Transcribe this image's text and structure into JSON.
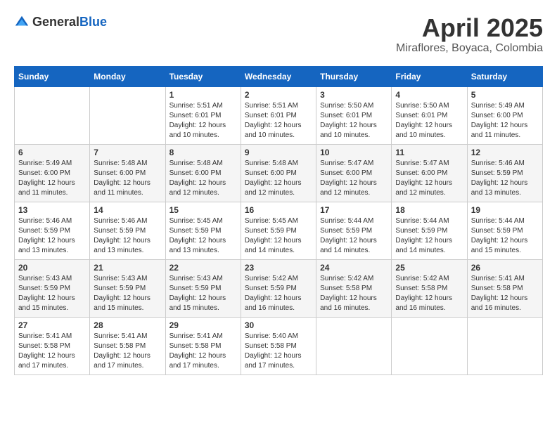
{
  "logo": {
    "general": "General",
    "blue": "Blue"
  },
  "title": "April 2025",
  "location": "Miraflores, Boyaca, Colombia",
  "days_of_week": [
    "Sunday",
    "Monday",
    "Tuesday",
    "Wednesday",
    "Thursday",
    "Friday",
    "Saturday"
  ],
  "weeks": [
    [
      {
        "day": "",
        "sunrise": "",
        "sunset": "",
        "daylight": ""
      },
      {
        "day": "",
        "sunrise": "",
        "sunset": "",
        "daylight": ""
      },
      {
        "day": "1",
        "sunrise": "Sunrise: 5:51 AM",
        "sunset": "Sunset: 6:01 PM",
        "daylight": "Daylight: 12 hours and 10 minutes."
      },
      {
        "day": "2",
        "sunrise": "Sunrise: 5:51 AM",
        "sunset": "Sunset: 6:01 PM",
        "daylight": "Daylight: 12 hours and 10 minutes."
      },
      {
        "day": "3",
        "sunrise": "Sunrise: 5:50 AM",
        "sunset": "Sunset: 6:01 PM",
        "daylight": "Daylight: 12 hours and 10 minutes."
      },
      {
        "day": "4",
        "sunrise": "Sunrise: 5:50 AM",
        "sunset": "Sunset: 6:01 PM",
        "daylight": "Daylight: 12 hours and 10 minutes."
      },
      {
        "day": "5",
        "sunrise": "Sunrise: 5:49 AM",
        "sunset": "Sunset: 6:00 PM",
        "daylight": "Daylight: 12 hours and 11 minutes."
      }
    ],
    [
      {
        "day": "6",
        "sunrise": "Sunrise: 5:49 AM",
        "sunset": "Sunset: 6:00 PM",
        "daylight": "Daylight: 12 hours and 11 minutes."
      },
      {
        "day": "7",
        "sunrise": "Sunrise: 5:48 AM",
        "sunset": "Sunset: 6:00 PM",
        "daylight": "Daylight: 12 hours and 11 minutes."
      },
      {
        "day": "8",
        "sunrise": "Sunrise: 5:48 AM",
        "sunset": "Sunset: 6:00 PM",
        "daylight": "Daylight: 12 hours and 12 minutes."
      },
      {
        "day": "9",
        "sunrise": "Sunrise: 5:48 AM",
        "sunset": "Sunset: 6:00 PM",
        "daylight": "Daylight: 12 hours and 12 minutes."
      },
      {
        "day": "10",
        "sunrise": "Sunrise: 5:47 AM",
        "sunset": "Sunset: 6:00 PM",
        "daylight": "Daylight: 12 hours and 12 minutes."
      },
      {
        "day": "11",
        "sunrise": "Sunrise: 5:47 AM",
        "sunset": "Sunset: 6:00 PM",
        "daylight": "Daylight: 12 hours and 12 minutes."
      },
      {
        "day": "12",
        "sunrise": "Sunrise: 5:46 AM",
        "sunset": "Sunset: 5:59 PM",
        "daylight": "Daylight: 12 hours and 13 minutes."
      }
    ],
    [
      {
        "day": "13",
        "sunrise": "Sunrise: 5:46 AM",
        "sunset": "Sunset: 5:59 PM",
        "daylight": "Daylight: 12 hours and 13 minutes."
      },
      {
        "day": "14",
        "sunrise": "Sunrise: 5:46 AM",
        "sunset": "Sunset: 5:59 PM",
        "daylight": "Daylight: 12 hours and 13 minutes."
      },
      {
        "day": "15",
        "sunrise": "Sunrise: 5:45 AM",
        "sunset": "Sunset: 5:59 PM",
        "daylight": "Daylight: 12 hours and 13 minutes."
      },
      {
        "day": "16",
        "sunrise": "Sunrise: 5:45 AM",
        "sunset": "Sunset: 5:59 PM",
        "daylight": "Daylight: 12 hours and 14 minutes."
      },
      {
        "day": "17",
        "sunrise": "Sunrise: 5:44 AM",
        "sunset": "Sunset: 5:59 PM",
        "daylight": "Daylight: 12 hours and 14 minutes."
      },
      {
        "day": "18",
        "sunrise": "Sunrise: 5:44 AM",
        "sunset": "Sunset: 5:59 PM",
        "daylight": "Daylight: 12 hours and 14 minutes."
      },
      {
        "day": "19",
        "sunrise": "Sunrise: 5:44 AM",
        "sunset": "Sunset: 5:59 PM",
        "daylight": "Daylight: 12 hours and 15 minutes."
      }
    ],
    [
      {
        "day": "20",
        "sunrise": "Sunrise: 5:43 AM",
        "sunset": "Sunset: 5:59 PM",
        "daylight": "Daylight: 12 hours and 15 minutes."
      },
      {
        "day": "21",
        "sunrise": "Sunrise: 5:43 AM",
        "sunset": "Sunset: 5:59 PM",
        "daylight": "Daylight: 12 hours and 15 minutes."
      },
      {
        "day": "22",
        "sunrise": "Sunrise: 5:43 AM",
        "sunset": "Sunset: 5:59 PM",
        "daylight": "Daylight: 12 hours and 15 minutes."
      },
      {
        "day": "23",
        "sunrise": "Sunrise: 5:42 AM",
        "sunset": "Sunset: 5:59 PM",
        "daylight": "Daylight: 12 hours and 16 minutes."
      },
      {
        "day": "24",
        "sunrise": "Sunrise: 5:42 AM",
        "sunset": "Sunset: 5:58 PM",
        "daylight": "Daylight: 12 hours and 16 minutes."
      },
      {
        "day": "25",
        "sunrise": "Sunrise: 5:42 AM",
        "sunset": "Sunset: 5:58 PM",
        "daylight": "Daylight: 12 hours and 16 minutes."
      },
      {
        "day": "26",
        "sunrise": "Sunrise: 5:41 AM",
        "sunset": "Sunset: 5:58 PM",
        "daylight": "Daylight: 12 hours and 16 minutes."
      }
    ],
    [
      {
        "day": "27",
        "sunrise": "Sunrise: 5:41 AM",
        "sunset": "Sunset: 5:58 PM",
        "daylight": "Daylight: 12 hours and 17 minutes."
      },
      {
        "day": "28",
        "sunrise": "Sunrise: 5:41 AM",
        "sunset": "Sunset: 5:58 PM",
        "daylight": "Daylight: 12 hours and 17 minutes."
      },
      {
        "day": "29",
        "sunrise": "Sunrise: 5:41 AM",
        "sunset": "Sunset: 5:58 PM",
        "daylight": "Daylight: 12 hours and 17 minutes."
      },
      {
        "day": "30",
        "sunrise": "Sunrise: 5:40 AM",
        "sunset": "Sunset: 5:58 PM",
        "daylight": "Daylight: 12 hours and 17 minutes."
      },
      {
        "day": "",
        "sunrise": "",
        "sunset": "",
        "daylight": ""
      },
      {
        "day": "",
        "sunrise": "",
        "sunset": "",
        "daylight": ""
      },
      {
        "day": "",
        "sunrise": "",
        "sunset": "",
        "daylight": ""
      }
    ]
  ]
}
